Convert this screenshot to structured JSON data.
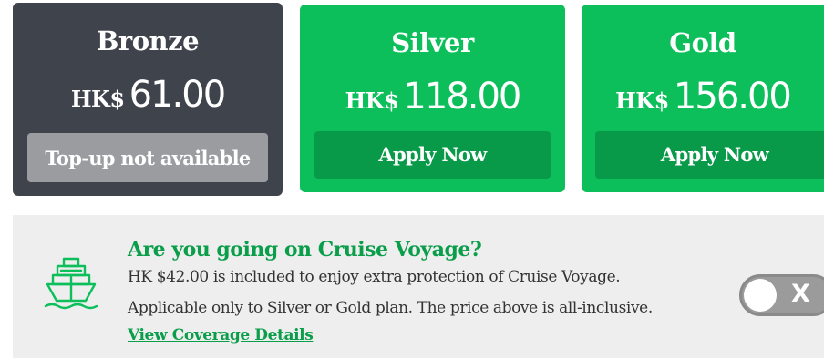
{
  "plans": [
    {
      "name": "Bronze",
      "currency": "HK$",
      "price": "61.00",
      "button": "Top-up not available"
    },
    {
      "name": "Silver",
      "currency": "HK$",
      "price": "118.00",
      "button": "Apply Now"
    },
    {
      "name": "Gold",
      "currency": "HK$",
      "price": "156.00",
      "button": "Apply Now"
    }
  ],
  "cruise": {
    "title": "Are you going on Cruise Voyage?",
    "line1": "HK $42.00 is included to enjoy extra protection of Cruise Voyage.",
    "line2": "Applicable only to Silver or Gold plan. The price above is all-inclusive.",
    "link": "View Coverage Details",
    "toggle_label": "X",
    "icon": "cruise-ship-icon"
  },
  "colors": {
    "green": "#0cbf5a",
    "dark_green": "#089a49",
    "slate": "#3f434b",
    "disabled_gray": "#9a9c9f"
  }
}
